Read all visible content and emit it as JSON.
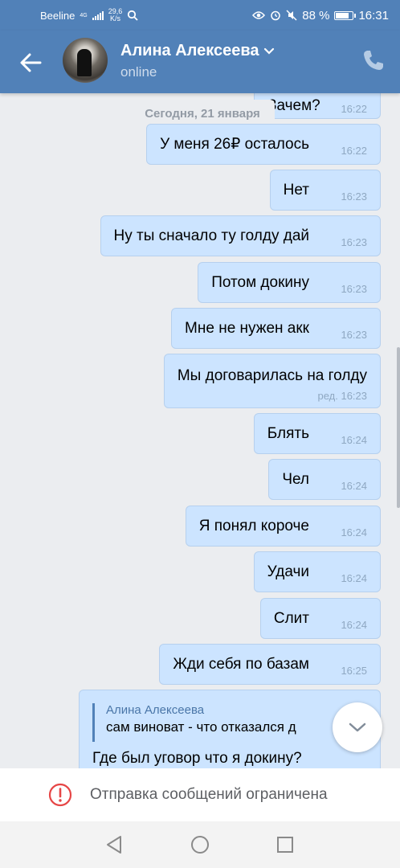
{
  "status_bar": {
    "carrier": "Beeline",
    "network_type": "4G",
    "speed_value": "29,6",
    "speed_unit": "K/s",
    "battery": "88 %",
    "battery_level": 0.88,
    "time": "16:31"
  },
  "header": {
    "contact_name": "Алина Алексеева",
    "status": "online"
  },
  "chat": {
    "date": "Сегодня, 21 января",
    "messages": [
      {
        "text": "Зачем?",
        "time": "16:22"
      },
      {
        "text": "У меня 26₽ осталось",
        "time": "16:22"
      },
      {
        "text": "Нет",
        "time": "16:23"
      },
      {
        "text": "Ну ты сначало ту голду дай",
        "time": "16:23"
      },
      {
        "text": "Потом докину",
        "time": "16:23"
      },
      {
        "text": "Мне не нужен акк",
        "time": "16:23"
      },
      {
        "text": "Мы договарилась на голду",
        "time": "ред. 16:23"
      },
      {
        "text": "Блять",
        "time": "16:24"
      },
      {
        "text": "Чел",
        "time": "16:24"
      },
      {
        "text": "Я понял короче",
        "time": "16:24"
      },
      {
        "text": "Удачи",
        "time": "16:24"
      },
      {
        "text": "Слит",
        "time": "16:24"
      },
      {
        "text": "Жди себя по базам",
        "time": "16:25"
      }
    ],
    "reply": {
      "quoted_author": "Алина Алексеева",
      "quoted_text": "сам виноват - что отказался д",
      "text": "Где был уговор что я докину?"
    }
  },
  "restriction": {
    "text": "Отправка сообщений ограничена"
  },
  "colors": {
    "header_bg": "#5181b8",
    "bubble_bg": "#cce4ff",
    "chat_bg": "#ebedf0",
    "warning": "#e64646"
  },
  "icons": {
    "back": "arrow-left-icon",
    "call": "phone-icon",
    "dropdown": "chevron-down-icon",
    "scroll_down": "chevron-down-icon",
    "warning": "exclamation-circle-icon"
  }
}
